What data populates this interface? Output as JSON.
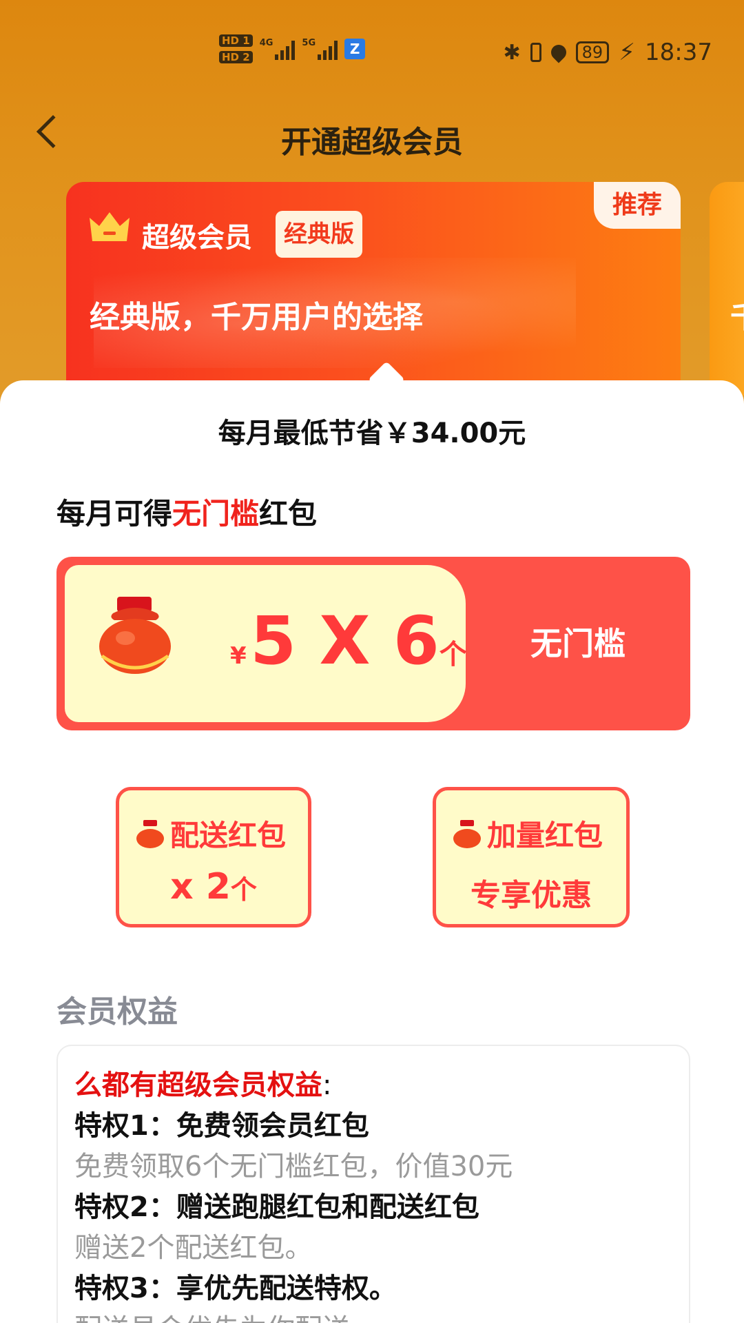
{
  "status_bar": {
    "hd1": "HD",
    "hd1_sub": "1",
    "hd2": "HD",
    "hd2_sub": "2",
    "signal1": "4G",
    "signal2": "5G",
    "battery": "89",
    "time": "18:37"
  },
  "nav": {
    "title": "开通超级会员"
  },
  "promo_card": {
    "name": "超级会员",
    "edition": "经典版",
    "slogan": "经典版，千万用户的选择",
    "tag": "推荐",
    "next_card_text": "千"
  },
  "saving": "每月最低节省￥34.00元",
  "subhead": {
    "prefix": "每月可得",
    "highlight": "无门槛",
    "suffix": "红包"
  },
  "red_packet": {
    "currency": "¥",
    "amount": "5 X 6",
    "unit": "个",
    "side_label": "无门槛"
  },
  "delivery_coupon": {
    "title": "配送红包",
    "count": "x 2",
    "unit": "个"
  },
  "boost_coupon": {
    "title": "加量红包",
    "subtitle": "专享优惠"
  },
  "benefits_section_title": "会员权益",
  "benefits": {
    "heading": "么都有超级会员权益",
    "heading_suffix": ":",
    "items": [
      {
        "title": "特权1：免费领会员红包",
        "desc": "免费领取6个无门槛红包，价值30元"
      },
      {
        "title": "特权2：赠送跑腿红包和配送红包",
        "desc": "赠送2个配送红包。"
      },
      {
        "title": "特权3：享优先配送特权。",
        "desc": "配送员会优先为你配送。"
      }
    ]
  },
  "colors": {
    "header_bg": "#dd870f",
    "card_red": "#f7321f",
    "accent_red": "#fe5248",
    "coupon_bg": "#fffbc9"
  }
}
